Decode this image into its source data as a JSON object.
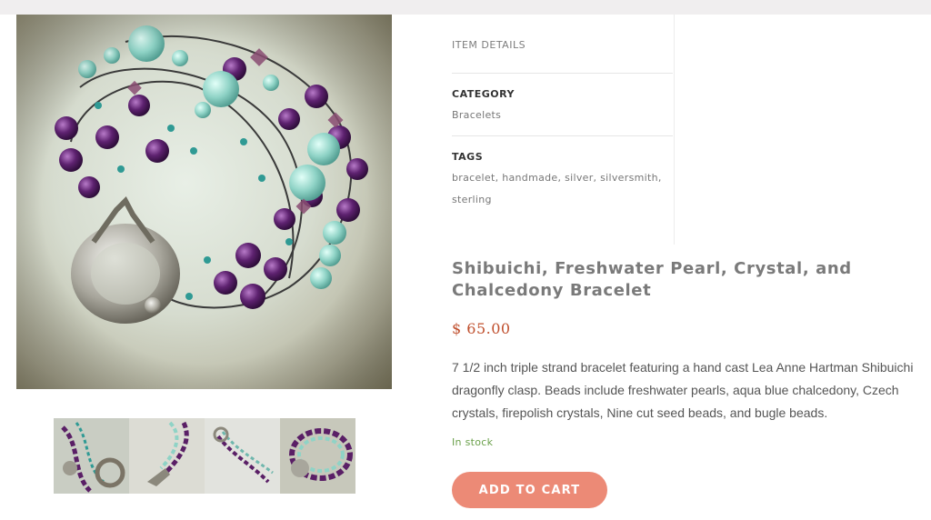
{
  "details": {
    "heading": "ITEM DETAILS",
    "category_label": "CATEGORY",
    "category_value": "Bracelets",
    "tags_label": "TAGS",
    "tags": [
      "bracelet",
      "handmade",
      "silver",
      "silversmith",
      "sterling"
    ]
  },
  "product": {
    "title": "Shibuichi, Freshwater Pearl, Crystal, and Chalcedony Bracelet",
    "price": "$ 65.00",
    "description": "7 1/2 inch triple strand bracelet featuring a hand cast Lea Anne Hartman Shibuichi dragonfly clasp. Beads include freshwater pearls, aqua blue chalcedony, Czech crystals, firepolish crystals, Nine cut seed beads, and bugle beads.",
    "stock": "In stock",
    "add_to_cart": "ADD TO CART"
  },
  "colors": {
    "price": "#c0502e",
    "stock": "#6aa04a",
    "button": "#ec8a76",
    "pearl_purple": "#5a1f66",
    "aqua": "#8fd3c6"
  }
}
